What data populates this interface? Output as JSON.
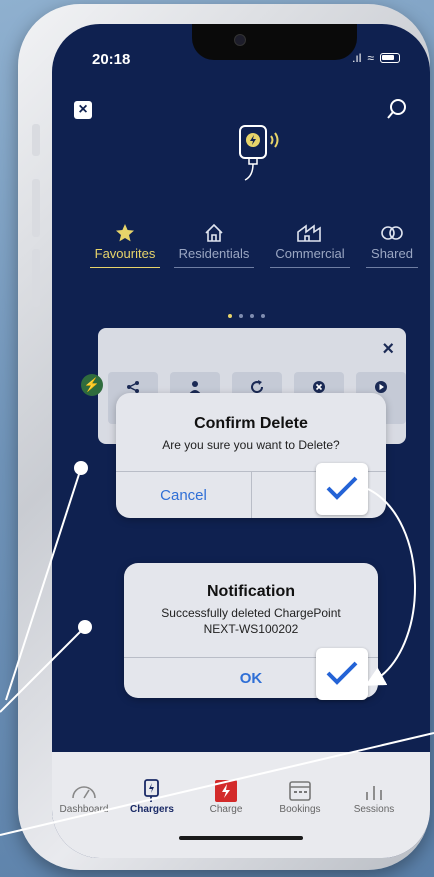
{
  "status_bar": {
    "time": "20:18"
  },
  "header": {
    "close_icon": "close-icon",
    "search_icon": "search-icon"
  },
  "tabs": [
    {
      "label": "Favourites",
      "icon": "star-icon",
      "active": true
    },
    {
      "label": "Residentials",
      "icon": "house-icon",
      "active": false
    },
    {
      "label": "Commercial",
      "icon": "building-icon",
      "active": false
    },
    {
      "label": "Shared",
      "icon": "link-icon",
      "active": false
    }
  ],
  "card": {
    "close": "×"
  },
  "confirm_dialog": {
    "title": "Confirm Delete",
    "message": "Are you sure you want to Delete?",
    "cancel": "Cancel",
    "ok": "Ok"
  },
  "notification_dialog": {
    "title": "Notification",
    "message_line1": "Successfully deleted ChargePoint",
    "message_line2": "NEXT-WS100202",
    "ok": "OK"
  },
  "bottom_nav": [
    {
      "label": "Dashboard",
      "icon": "gauge-icon",
      "active": false
    },
    {
      "label": "Chargers",
      "icon": "charger-icon",
      "active": true
    },
    {
      "label": "Charge",
      "icon": "bolt-icon",
      "active": false
    },
    {
      "label": "Bookings",
      "icon": "calendar-icon",
      "active": false
    },
    {
      "label": "Sessions",
      "icon": "bars-icon",
      "active": false
    }
  ],
  "colors": {
    "screen_bg": "#0f2150",
    "accent": "#e7d46a",
    "link_blue": "#2f6fd6",
    "charge_red": "#d32a2a"
  }
}
